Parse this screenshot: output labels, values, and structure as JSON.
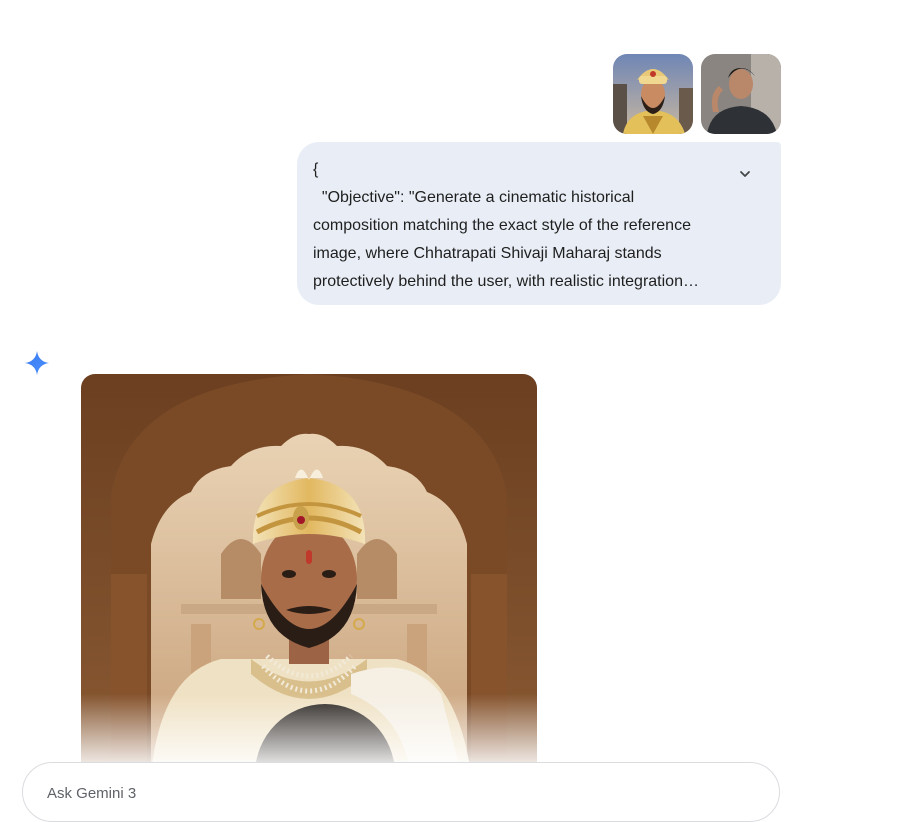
{
  "attachments": [
    {
      "icon": "shivaji-portrait-thumbnail"
    },
    {
      "icon": "user-photo-thumbnail"
    }
  ],
  "prompt": {
    "text": "{\n  \"Objective\": \"Generate a cinematic historical composition matching the exact style of the reference image, where Chhatrapati Shivaji Maharaj stands protectively behind the user, with realistic integration…",
    "expand_icon": "chevron-down-icon"
  },
  "response": {
    "avatar_icon": "gemini-sparkle-icon",
    "image_icon": "generated-image"
  },
  "composer": {
    "placeholder": "Ask Gemini 3"
  },
  "colors": {
    "bubble": "#e9eef6",
    "sparkle": "#4285f4"
  }
}
